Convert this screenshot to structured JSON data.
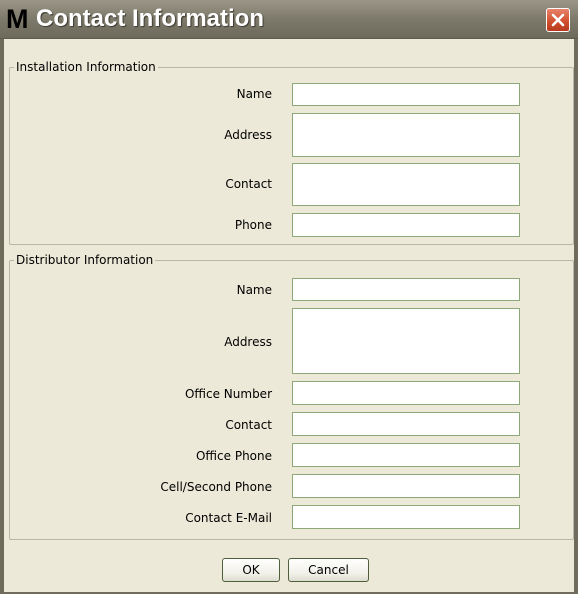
{
  "window": {
    "app_icon_letter": "M",
    "title": "Contact Information",
    "close_icon": "close-icon"
  },
  "installation": {
    "legend": "Installation Information",
    "name_label": "Name",
    "name_value": "",
    "address_label": "Address",
    "address_value": "",
    "contact_label": "Contact",
    "contact_value": "",
    "phone_label": "Phone",
    "phone_value": ""
  },
  "distributor": {
    "legend": "Distributor Information",
    "name_label": "Name",
    "name_value": "",
    "address_label": "Address",
    "address_value": "",
    "office_number_label": "Office Number",
    "office_number_value": "",
    "contact_label": "Contact",
    "contact_value": "",
    "office_phone_label": "Office Phone",
    "office_phone_value": "",
    "cell_phone_label": "Cell/Second Phone",
    "cell_phone_value": "",
    "email_label": "Contact E-Mail",
    "email_value": ""
  },
  "buttons": {
    "ok": "OK",
    "cancel": "Cancel"
  },
  "colors": {
    "window_bg": "#ece9d8",
    "titlebar": "#7e7a6b",
    "close_red": "#d2512f",
    "field_border": "#8fa878"
  }
}
